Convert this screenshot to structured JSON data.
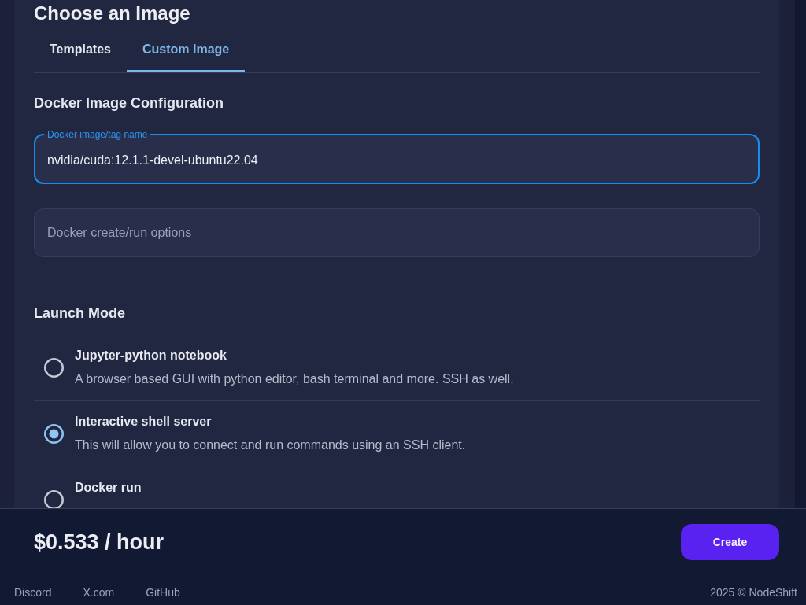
{
  "page": {
    "title": "Choose an Image"
  },
  "tabs": [
    {
      "label": "Templates",
      "selected": false
    },
    {
      "label": "Custom Image",
      "selected": true
    }
  ],
  "docker_config": {
    "heading": "Docker Image Configuration",
    "image_field": {
      "label": "Docker image/tag name",
      "value": "nvidia/cuda:12.1.1-devel-ubuntu22.04",
      "focused": true
    },
    "options_field": {
      "placeholder": "Docker create/run options"
    }
  },
  "launch_mode": {
    "heading": "Launch Mode",
    "options": [
      {
        "title": "Jupyter-python notebook",
        "description": "A browser based GUI with python editor, bash terminal and more. SSH as well.",
        "selected": false
      },
      {
        "title": "Interactive shell server",
        "description": "This will allow you to connect and run commands using an SSH client.",
        "selected": true
      },
      {
        "title": "Docker run",
        "selected": false
      }
    ]
  },
  "footer": {
    "price": "$0.533 / hour",
    "create_button": "Create",
    "links": [
      "Discord",
      "X.com",
      "GitHub"
    ],
    "copyright": "2025 © NodeShift"
  }
}
